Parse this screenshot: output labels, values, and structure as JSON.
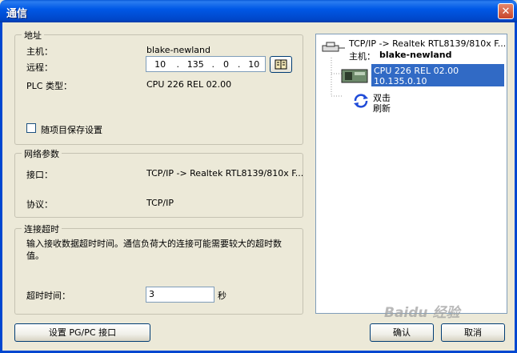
{
  "window": {
    "title": "通信",
    "close_glyph": "✕"
  },
  "address": {
    "group_title": "地址",
    "host_label": "主机：",
    "host_value": "blake-newland",
    "remote_label": "远程：",
    "ip": [
      "10",
      "135",
      "0",
      "10"
    ],
    "plc_type_label": "PLC 类型：",
    "plc_type_value": "CPU 226 REL 02.00",
    "save_with_project_label": "随项目保存设置",
    "save_with_project_checked": false
  },
  "network": {
    "group_title": "网络参数",
    "interface_label": "接口：",
    "interface_value": "TCP/IP -> Realtek RTL8139/810x F...",
    "protocol_label": "协议：",
    "protocol_value": "TCP/IP"
  },
  "timeout": {
    "group_title": "连接超时",
    "description": "输入接收数据超时时间。通信负荷大的连接可能需要较大的超时数值。",
    "label": "超时时间：",
    "value": "3",
    "unit": "秒"
  },
  "tree": {
    "root_label": "TCP/IP -> Realtek RTL8139/810x F...",
    "host_prefix": "主机：",
    "host_name": "blake-newland",
    "device_name": "CPU 226 REL 02.00",
    "device_ip": "10.135.0.10",
    "refresh_line1": "双击",
    "refresh_line2": "刷新"
  },
  "buttons": {
    "set_pgpc": "设置 PG/PC 接口",
    "ok": "确认",
    "cancel": "取消"
  },
  "watermark": "Baidu 经验",
  "colors": {
    "selection": "#316ac5",
    "titlebar": "#0058e6",
    "dialog_bg": "#ece9d8"
  }
}
